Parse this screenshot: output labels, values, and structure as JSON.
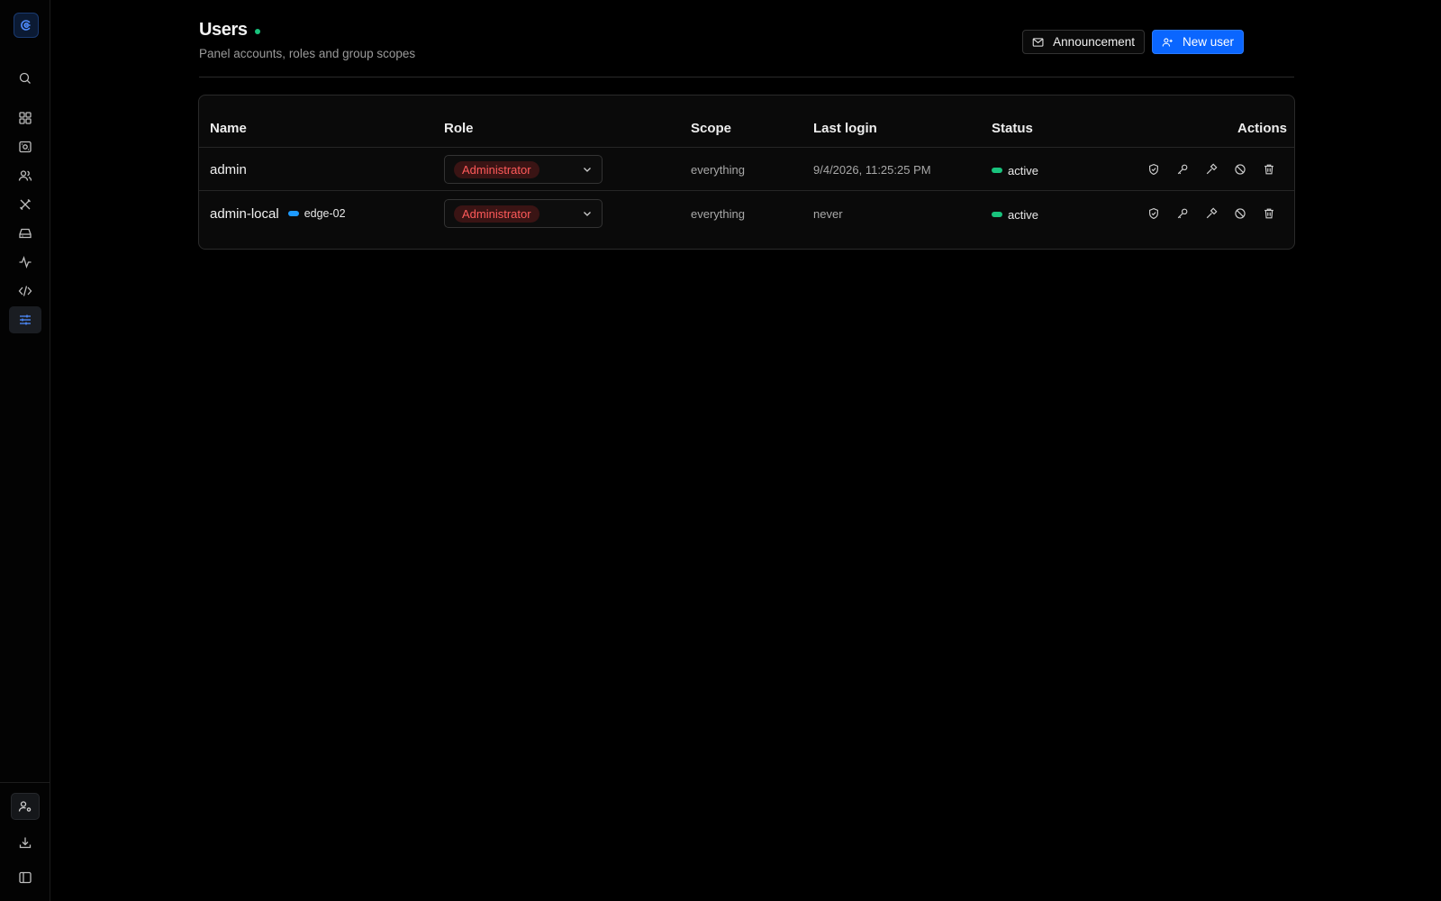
{
  "sidebar": {
    "logo_icon": "logo-icon",
    "items": [
      {
        "name": "search",
        "icon": "search-icon"
      },
      {
        "name": "dashboard",
        "icon": "grid-icon"
      },
      {
        "name": "servers",
        "icon": "server-icon"
      },
      {
        "name": "users",
        "icon": "users-icon"
      },
      {
        "name": "tools",
        "icon": "tools-icon"
      },
      {
        "name": "storage",
        "icon": "drive-icon"
      },
      {
        "name": "activity",
        "icon": "activity-icon"
      },
      {
        "name": "code",
        "icon": "code-icon"
      },
      {
        "name": "settings",
        "icon": "sliders-icon",
        "active": true
      }
    ],
    "bottom": [
      {
        "name": "account",
        "icon": "user-settings-icon"
      },
      {
        "name": "download",
        "icon": "download-icon"
      },
      {
        "name": "collapse",
        "icon": "sidebar-toggle-icon"
      }
    ]
  },
  "header": {
    "title": "Users",
    "subtitle": "Panel accounts, roles and group scopes",
    "announcement_label": "Announcement",
    "new_user_label": "New user"
  },
  "table": {
    "columns": {
      "name": "Name",
      "role": "Role",
      "scope": "Scope",
      "last_login": "Last login",
      "status": "Status",
      "actions": "Actions"
    },
    "rows": [
      {
        "name": "admin",
        "tag": "",
        "role": "Administrator",
        "scope": "everything",
        "last_login": "9/4/2026, 11:25:25 PM",
        "status": "active"
      },
      {
        "name": "admin-local",
        "tag": "edge-02",
        "role": "Administrator",
        "scope": "everything",
        "last_login": "never",
        "status": "active"
      }
    ],
    "action_icons": [
      "shield-icon",
      "key-icon",
      "hammer-icon",
      "ban-icon",
      "trash-icon"
    ]
  },
  "colors": {
    "accent": "#0a66ff",
    "status_active": "#19c37d",
    "role_admin_text": "#ff5a5a",
    "tag_dot": "#1e9bff"
  }
}
